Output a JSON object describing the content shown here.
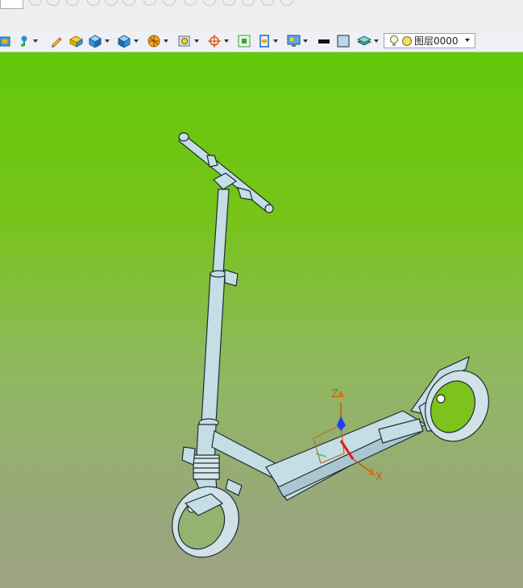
{
  "toolbar": {
    "layer_select": {
      "value": "图层0000",
      "bulb_icon": "lightbulb-icon",
      "status_icon": "yellow-dot-icon"
    },
    "buttons": [
      "view-icon",
      "pin-icon",
      "pencil-icon",
      "yellow-box-icon",
      "blue-cube-icon",
      "blue-cube2-icon",
      "sphere-icon",
      "zoom-icon",
      "target-icon",
      "fit-icon",
      "height-icon",
      "monitor-icon",
      "black-line-icon",
      "color-swatch-icon",
      "layer-stack-icon"
    ]
  },
  "viewport": {
    "model": "kick-scooter",
    "background_top": "#62c80a",
    "background_bottom": "#9da283",
    "triad": {
      "z_label": "Z",
      "x_label": "X",
      "z_color": "#1f3cff",
      "x_color": "#e01b1b",
      "label_color": "#c0610c"
    }
  }
}
